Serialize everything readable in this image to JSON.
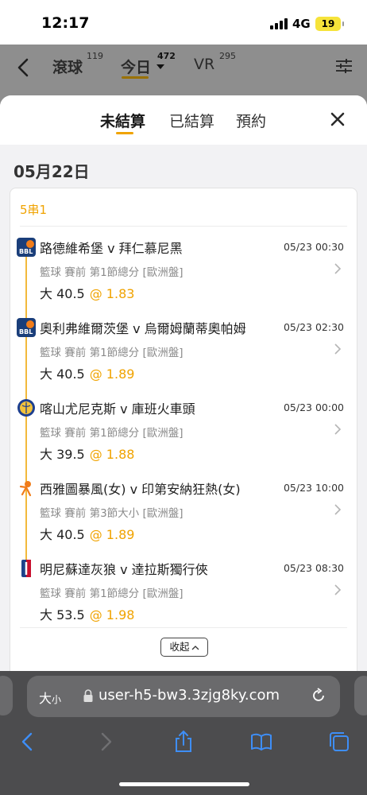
{
  "status_bar": {
    "time": "12:17",
    "network": "4G",
    "battery": "19"
  },
  "top_nav": {
    "tabs": [
      {
        "label": "滾球",
        "count": "119"
      },
      {
        "label": "今日",
        "count": "472"
      },
      {
        "label": "VR",
        "count": "295"
      }
    ],
    "active_index": 1
  },
  "sheet": {
    "tabs": [
      "未結算",
      "已結算",
      "預約"
    ],
    "active_index": 0,
    "date": "05月22日",
    "bet": {
      "type": "5串1",
      "legs": [
        {
          "league_icon": "bbl-icon",
          "teams": "路德維希堡 v 拜仁慕尼黑",
          "time": "05/23 00:30",
          "meta": "籃球  賽前  第1節總分 [歐洲盤]",
          "pick": "大 40.5",
          "odds": "@ 1.83"
        },
        {
          "league_icon": "bbl-icon",
          "teams": "奧利弗維爾茨堡 v 烏爾姆蘭蒂奧帕姆",
          "time": "05/23 02:30",
          "meta": "籃球  賽前  第1節總分 [歐洲盤]",
          "pick": "大 40.5",
          "odds": "@ 1.89"
        },
        {
          "league_icon": "basketball-league-icon",
          "teams": "喀山尤尼克斯 v 庫班火車頭",
          "time": "05/23 00:00",
          "meta": "籃球  賽前  第1節總分 [歐洲盤]",
          "pick": "大 39.5",
          "odds": "@ 1.88"
        },
        {
          "league_icon": "wnba-icon",
          "teams": "西雅圖暴風(女) v 印第安納狂熱(女)",
          "time": "05/23 10:00",
          "meta": "籃球  賽前  第3節大小 [歐洲盤]",
          "pick": "大 40.5",
          "odds": "@ 1.89"
        },
        {
          "league_icon": "nba-icon",
          "teams": "明尼蘇達灰狼 v 達拉斯獨行俠",
          "time": "05/23 08:30",
          "meta": "籃球  賽前  第1節總分 [歐洲盤]",
          "pick": "大 53.5",
          "odds": "@ 1.98"
        }
      ],
      "collapse_label": "收起"
    }
  },
  "browser": {
    "text_size_label": "大",
    "text_size_small": "小",
    "url": "user-h5-bw3.3zjg8ky.com"
  },
  "colors": {
    "accent": "#f0a300",
    "timeline": "#f2b93b"
  }
}
